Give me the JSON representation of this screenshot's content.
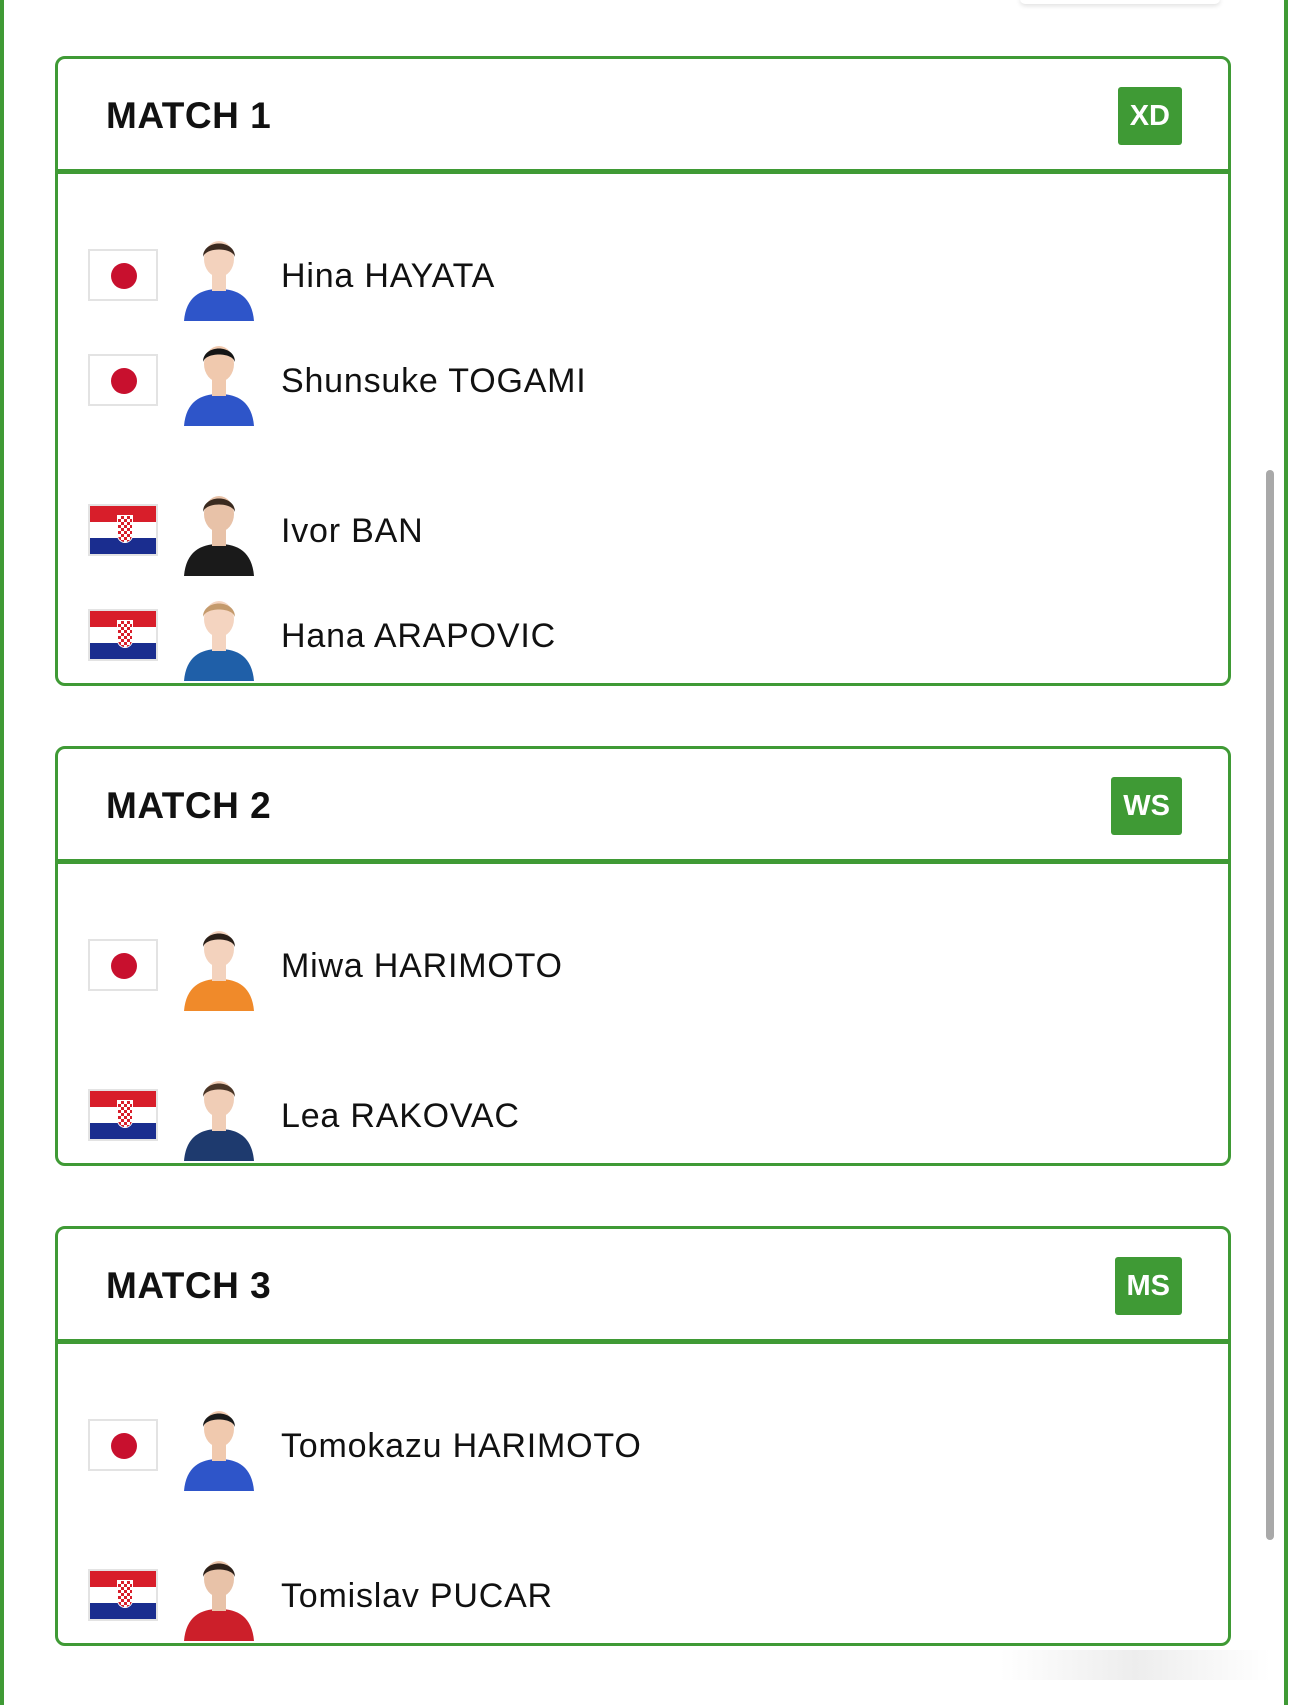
{
  "colors": {
    "accent_green": "#3f9a35",
    "japan_red": "#c8102e",
    "croatia_red": "#d81e2a",
    "croatia_blue": "#1a2d8f"
  },
  "matches": [
    {
      "title": "MATCH 1",
      "badge": "XD",
      "players": [
        {
          "name": "Hina HAYATA",
          "flag": "japan-flag-icon",
          "jersey": "#2e55c9",
          "hair": "#3b2a20",
          "skin": "#f3d2bd"
        },
        {
          "name": "Shunsuke TOGAMI",
          "flag": "japan-flag-icon",
          "jersey": "#2e55c9",
          "hair": "#151515",
          "skin": "#f0c9ae"
        },
        {
          "name": "Ivor BAN",
          "flag": "croatia-flag-icon",
          "jersey": "#1a1a1a",
          "hair": "#3a2a1f",
          "skin": "#e8c2a8"
        },
        {
          "name": "Hana ARAPOVIC",
          "flag": "croatia-flag-icon",
          "jersey": "#1f5fa8",
          "hair": "#c49a6c",
          "skin": "#f4d4c0"
        }
      ]
    },
    {
      "title": "MATCH 2",
      "badge": "WS",
      "players": [
        {
          "name": "Miwa HARIMOTO",
          "flag": "japan-flag-icon",
          "jersey": "#f08a2a",
          "hair": "#2a1f18",
          "skin": "#f3d2bd"
        },
        {
          "name": "Lea RAKOVAC",
          "flag": "croatia-flag-icon",
          "jersey": "#1e3a6e",
          "hair": "#4a3526",
          "skin": "#f0cdb6"
        }
      ]
    },
    {
      "title": "MATCH 3",
      "badge": "MS",
      "players": [
        {
          "name": "Tomokazu HARIMOTO",
          "flag": "japan-flag-icon",
          "jersey": "#2e55c9",
          "hair": "#1a1a1a",
          "skin": "#f0c9ae"
        },
        {
          "name": "Tomislav PUCAR",
          "flag": "croatia-flag-icon",
          "jersey": "#cc1f2a",
          "hair": "#2d2019",
          "skin": "#e8c2a8"
        }
      ]
    }
  ]
}
